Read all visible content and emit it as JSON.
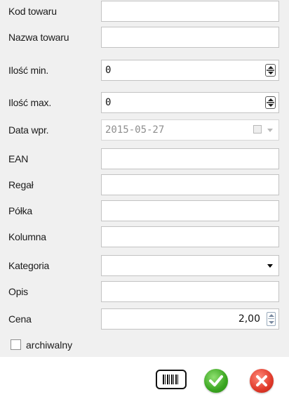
{
  "form": {
    "kod_towaru": {
      "label": "Kod towaru",
      "value": ""
    },
    "nazwa_towaru": {
      "label": "Nazwa towaru",
      "value": ""
    },
    "ilosc_min": {
      "label": "Ilość min.",
      "value": "0"
    },
    "ilosc_max": {
      "label": "Ilość max.",
      "value": "0"
    },
    "data_wpr": {
      "label": "Data wpr.",
      "value": "2015-05-27"
    },
    "ean": {
      "label": "EAN",
      "value": ""
    },
    "regal": {
      "label": "Regał",
      "value": ""
    },
    "polka": {
      "label": "Półka",
      "value": ""
    },
    "kolumna": {
      "label": "Kolumna",
      "value": ""
    },
    "kategoria": {
      "label": "Kategoria",
      "value": ""
    },
    "opis": {
      "label": "Opis",
      "value": ""
    },
    "cena": {
      "label": "Cena",
      "value": "2,00"
    },
    "archiwalny": {
      "label": "archiwalny",
      "checked": false
    }
  },
  "toolbar": {
    "barcode_icon": "barcode-icon",
    "ok_icon": "green-check-icon",
    "cancel_icon": "red-x-icon"
  },
  "colors": {
    "panel_bg": "#f0f0f0",
    "ok": "#3aa520",
    "cancel": "#e03a2a"
  }
}
